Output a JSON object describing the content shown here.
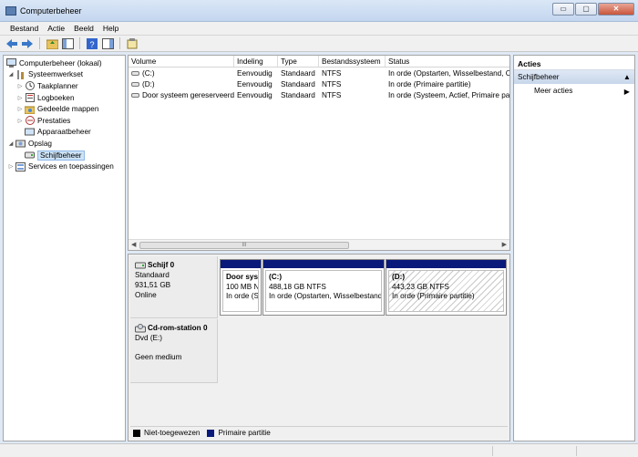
{
  "window": {
    "title": "Computerbeheer",
    "minimize": "▭",
    "maximize": "▢",
    "close": "✕"
  },
  "menu": [
    "Bestand",
    "Actie",
    "Beeld",
    "Help"
  ],
  "tree": {
    "root": "Computerbeheer (lokaal)",
    "system_tools": "Systeemwerkset",
    "task_scheduler": "Taakplanner",
    "event_viewer": "Logboeken",
    "shared_folders": "Gedeelde mappen",
    "performance": "Prestaties",
    "device_manager": "Apparaatbeheer",
    "storage": "Opslag",
    "disk_management": "Schijfbeheer",
    "services": "Services en toepassingen"
  },
  "list": {
    "columns": [
      "Volume",
      "Indeling",
      "Type",
      "Bestandssysteem",
      "Status"
    ],
    "rows": [
      [
        "(C:)",
        "Eenvoudig",
        "Standaard",
        "NTFS",
        "In orde (Opstarten, Wisselbestand, C"
      ],
      [
        "(D:)",
        "Eenvoudig",
        "Standaard",
        "NTFS",
        "In orde (Primaire partitie)"
      ],
      [
        "Door systeem gereserveerd",
        "Eenvoudig",
        "Standaard",
        "NTFS",
        "In orde (Systeem, Actief, Primaire pa"
      ]
    ],
    "scroll_grip": "III"
  },
  "disk0": {
    "name": "Schijf 0",
    "type": "Standaard",
    "size": "931,51 GB",
    "status": "Online",
    "partitions": [
      {
        "name": "Door syst",
        "size": "100 MB N",
        "status": "In orde (S"
      },
      {
        "name": "(C:)",
        "size": "488,18 GB NTFS",
        "status": "In orde (Opstarten, Wisselbestand"
      },
      {
        "name": "(D:)",
        "size": "443,23 GB NTFS",
        "status": "In orde (Primaire partitie)"
      }
    ]
  },
  "cdrom0": {
    "name": "Cd-rom-station 0",
    "type": "Dvd (E:)",
    "media": "Geen medium"
  },
  "legend": {
    "unallocated": "Niet-toegewezen",
    "primary": "Primaire partitie"
  },
  "actions": {
    "header": "Acties",
    "section": "Schijfbeheer",
    "more": "Meer acties"
  },
  "colors": {
    "primary_partition": "#0a1a7a",
    "unallocated": "#000000",
    "selection": "#cde3f7"
  }
}
